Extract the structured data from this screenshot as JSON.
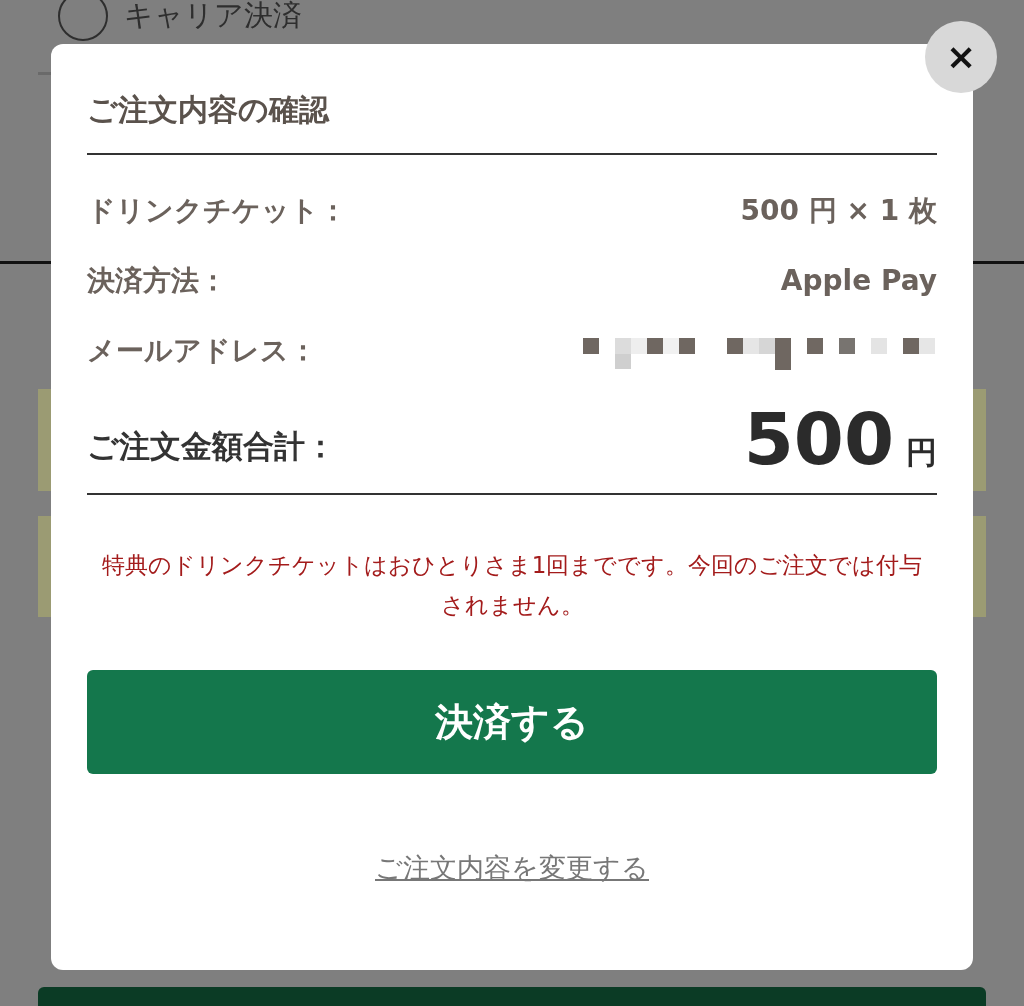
{
  "background": {
    "payment_option": {
      "label": "キャリア決済",
      "selected": false
    }
  },
  "dialog": {
    "title": "ご注文内容の確認",
    "close": "×",
    "rows": [
      {
        "label": "ドリンクチケット：",
        "value": "500 円 × 1 枚",
        "kind": "text"
      },
      {
        "label": "決済方法：",
        "value": "Apple Pay",
        "kind": "text"
      },
      {
        "label": "メールアドレス：",
        "kind": "redacted"
      }
    ],
    "total": {
      "label": "ご注文金額合計：",
      "amount": "500",
      "unit": "円"
    },
    "notice": "特典のドリンクチケットはおひとりさま1回までです。今回のご注文では付与されません。",
    "pay_button": "決済する",
    "change_link": "ご注文内容を変更する"
  }
}
